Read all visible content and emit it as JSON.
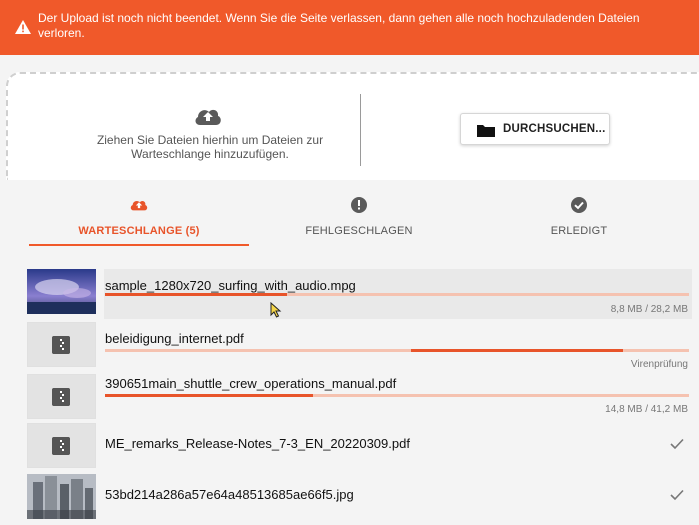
{
  "banner": {
    "message": "Der Upload ist noch nicht beendet. Wenn Sie die Seite verlassen, dann gehen alle noch hochzuladenden Dateien verloren.",
    "color": "#f0592a"
  },
  "dropzone": {
    "text": "Ziehen Sie Dateien hierhin um Dateien zur Warteschlange hinzuzufügen.",
    "browse_label": "DURCHSUCHEN..."
  },
  "tabs": [
    {
      "label": "WARTESCHLANGE (5)",
      "icon": "cloud-upload-icon",
      "active": true
    },
    {
      "label": "FEHLGESCHLAGEN",
      "icon": "alert-icon",
      "active": false
    },
    {
      "label": "ERLEDIGT",
      "icon": "check-circle-icon",
      "active": false
    }
  ],
  "files": [
    {
      "name": "sample_1280x720_surfing_with_audio.mpg",
      "status": "8,8 MB / 28,2 MB",
      "progress": 0.31
    },
    {
      "name": "beleidigung_internet.pdf",
      "status": "Virenprüfung",
      "progress": null
    },
    {
      "name": "390651main_shuttle_crew_operations_manual.pdf",
      "status": "14,8 MB / 41,2 MB",
      "progress": 0.36
    },
    {
      "name": "ME_remarks_Release-Notes_7-3_EN_20220309.pdf",
      "status": "",
      "done": true
    },
    {
      "name": "53bd214a286a57e64a48513685ae66f5.jpg",
      "status": "",
      "done": true
    }
  ]
}
